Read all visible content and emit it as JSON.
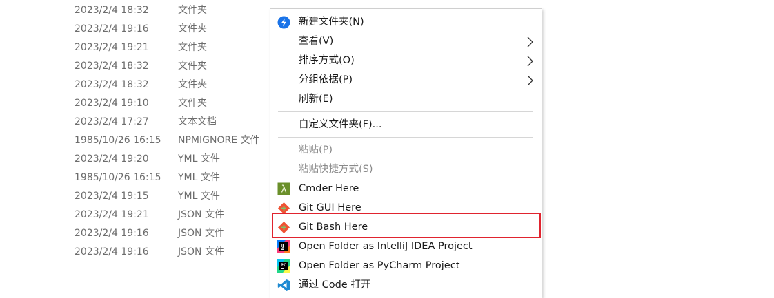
{
  "files": [
    {
      "date": "2023/2/4 18:32",
      "type": "文件夹"
    },
    {
      "date": "2023/2/4 19:16",
      "type": "文件夹"
    },
    {
      "date": "2023/2/4 19:21",
      "type": "文件夹"
    },
    {
      "date": "2023/2/4 18:32",
      "type": "文件夹"
    },
    {
      "date": "2023/2/4 18:32",
      "type": "文件夹"
    },
    {
      "date": "2023/2/4 19:10",
      "type": "文件夹"
    },
    {
      "date": "2023/2/4 17:27",
      "type": "文本文档"
    },
    {
      "date": "1985/10/26 16:15",
      "type": "NPMIGNORE 文件"
    },
    {
      "date": "2023/2/4 19:20",
      "type": "YML 文件"
    },
    {
      "date": "1985/10/26 16:15",
      "type": "YML 文件"
    },
    {
      "date": "2023/2/4 19:15",
      "type": "YML 文件"
    },
    {
      "date": "2023/2/4 19:21",
      "type": "JSON 文件"
    },
    {
      "date": "2023/2/4 19:16",
      "type": "JSON 文件"
    },
    {
      "date": "2023/2/4 19:16",
      "type": "JSON 文件"
    }
  ],
  "menu": {
    "new_folder": "新建文件夹(N)",
    "view": "查看(V)",
    "sort_by": "排序方式(O)",
    "group_by": "分组依据(P)",
    "refresh": "刷新(E)",
    "customize_folder": "自定义文件夹(F)...",
    "paste": "粘贴(P)",
    "paste_shortcut": "粘贴快捷方式(S)",
    "cmder_here": "Cmder Here",
    "git_gui_here": "Git GUI Here",
    "git_bash_here": "Git Bash Here",
    "open_intellij": "Open Folder as IntelliJ IDEA Project",
    "open_pycharm": "Open Folder as PyCharm Project",
    "open_with_code": "通过 Code 打开"
  },
  "icons": {
    "new_folder": "blue-circle-bolt-icon",
    "cmder": "lambda-icon",
    "git": "git-diamond-icon",
    "intellij": "intellij-idea-icon",
    "pycharm": "pycharm-icon",
    "vscode": "vscode-icon",
    "submenu": "chevron-right-icon"
  },
  "colors": {
    "highlight_border": "#e0242f",
    "git_orange": "#f05133",
    "cmder_green": "#6a8f2a"
  }
}
